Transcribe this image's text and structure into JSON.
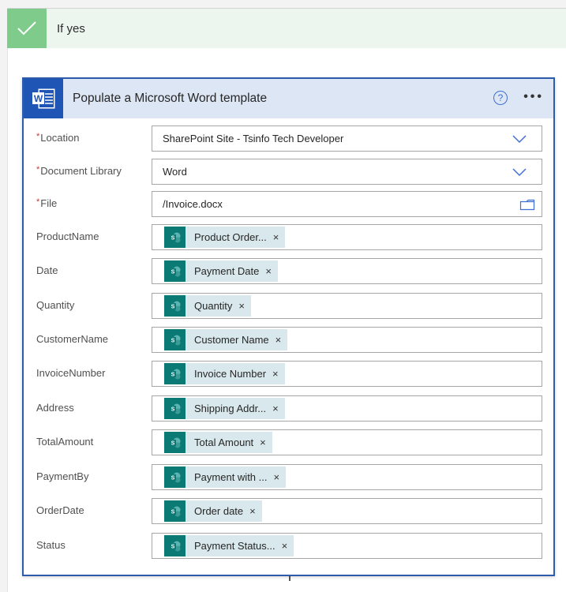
{
  "condition": {
    "label": "If yes",
    "icon": "checkmark-icon",
    "colors": {
      "icon_bg": "#7fcb8b",
      "bar_bg": "#ecf6ee"
    }
  },
  "action": {
    "title": "Populate a Microsoft Word template",
    "icon": "word-icon",
    "help_label": "?",
    "more_label": "•••",
    "colors": {
      "accent": "#2f5bab",
      "header_bg": "#dde6f5",
      "icon_bg": "#1f56b5",
      "token_icon_bg": "#0b7a75",
      "token_bg": "#d9e8ec",
      "required": "#c23934"
    }
  },
  "fields": [
    {
      "label": "Location",
      "required": true,
      "type": "dropdown",
      "value": "SharePoint Site - Tsinfo Tech Developer"
    },
    {
      "label": "Document Library",
      "required": true,
      "type": "dropdown",
      "value": "Word"
    },
    {
      "label": "File",
      "required": true,
      "type": "file",
      "value": "/Invoice.docx"
    },
    {
      "label": "ProductName",
      "required": false,
      "type": "token",
      "token": "Product Order...",
      "remove": "×"
    },
    {
      "label": "Date",
      "required": false,
      "type": "token",
      "token": "Payment Date",
      "remove": "×"
    },
    {
      "label": "Quantity",
      "required": false,
      "type": "token",
      "token": "Quantity",
      "remove": "×"
    },
    {
      "label": "CustomerName",
      "required": false,
      "type": "token",
      "token": "Customer Name",
      "remove": "×"
    },
    {
      "label": "InvoiceNumber",
      "required": false,
      "type": "token",
      "token": "Invoice Number",
      "remove": "×"
    },
    {
      "label": "Address",
      "required": false,
      "type": "token",
      "token": "Shipping Addr...",
      "remove": "×"
    },
    {
      "label": "TotalAmount",
      "required": false,
      "type": "token",
      "token": "Total Amount",
      "remove": "×"
    },
    {
      "label": "PaymentBy",
      "required": false,
      "type": "token",
      "token": "Payment with ...",
      "remove": "×"
    },
    {
      "label": "OrderDate",
      "required": false,
      "type": "token",
      "token": "Order date",
      "remove": "×"
    },
    {
      "label": "Status",
      "required": false,
      "type": "token",
      "token": "Payment Status...",
      "remove": "×"
    }
  ],
  "required_marker": "*"
}
